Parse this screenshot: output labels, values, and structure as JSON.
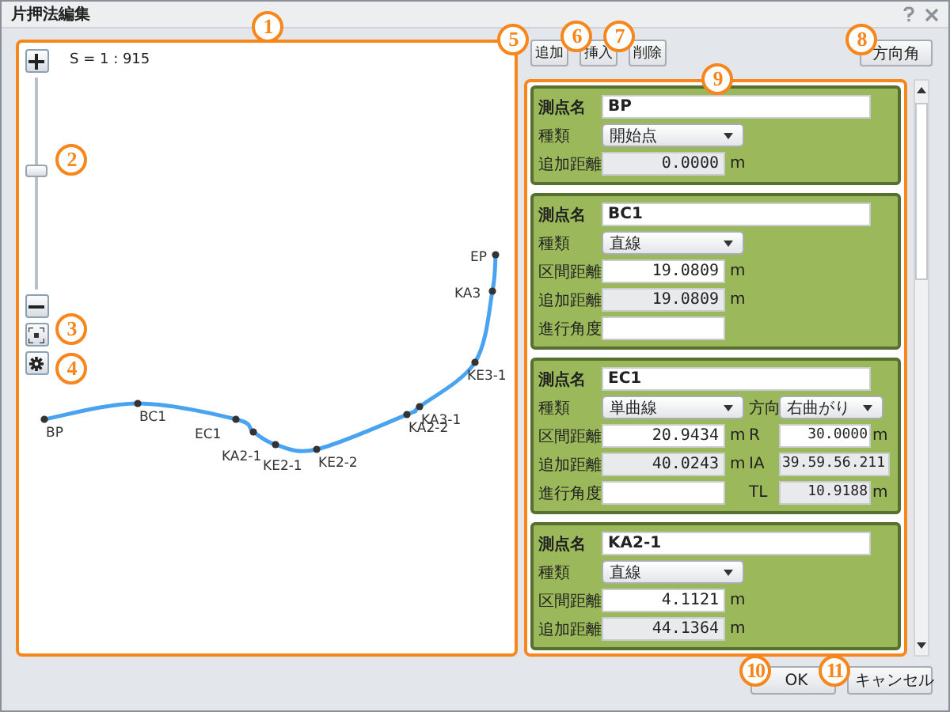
{
  "window": {
    "title": "片押法編集"
  },
  "map": {
    "scale": "S = 1 : 915",
    "zoom": {
      "level": 0.57
    },
    "points": [
      {
        "label": "BP"
      },
      {
        "label": "BC1"
      },
      {
        "label": "EC1"
      },
      {
        "label": "KA2-1"
      },
      {
        "label": "KE2-1"
      },
      {
        "label": "KE2-2"
      },
      {
        "label": "KA2-2"
      },
      {
        "label": "KA3-1"
      },
      {
        "label": "KE3-1"
      },
      {
        "label": "KA3"
      },
      {
        "label": "EP"
      }
    ]
  },
  "toolbar": [
    "追加",
    "挿入",
    "削除"
  ],
  "direction_button": "方向角",
  "cards": [
    {
      "rows": [
        [
          {
            "kind": "name",
            "label": "測点名",
            "value": "BP"
          }
        ],
        [
          {
            "kind": "select",
            "label": "種類",
            "value": "開始点"
          }
        ],
        [
          {
            "kind": "readonly",
            "label": "追加距離",
            "value": "0.0000",
            "unit": "m"
          }
        ]
      ]
    },
    {
      "rows": [
        [
          {
            "kind": "name",
            "label": "測点名",
            "value": "BC1"
          }
        ],
        [
          {
            "kind": "select",
            "label": "種類",
            "value": "直線"
          }
        ],
        [
          {
            "kind": "input",
            "label": "区間距離",
            "value": "19.0809",
            "unit": "m"
          }
        ],
        [
          {
            "kind": "readonly",
            "label": "追加距離",
            "value": "19.0809",
            "unit": "m"
          }
        ],
        [
          {
            "kind": "input",
            "label": "進行角度"
          }
        ]
      ]
    },
    {
      "rows": [
        [
          {
            "kind": "name",
            "label": "測点名",
            "value": "EC1"
          }
        ],
        [
          {
            "kind": "select",
            "label": "種類",
            "value": "単曲線"
          },
          {
            "kind": "select",
            "label": "方向",
            "value": "右曲がり"
          }
        ],
        [
          {
            "kind": "input",
            "label": "区間距離",
            "value": "20.9434",
            "unit": "m"
          },
          {
            "kind": "input",
            "label": "R",
            "value": "30.0000",
            "unit": "m"
          }
        ],
        [
          {
            "kind": "readonly",
            "label": "追加距離",
            "value": "40.0243",
            "unit": "m"
          },
          {
            "kind": "readonly",
            "label": "IA",
            "value": "39.59.56.211"
          }
        ],
        [
          {
            "kind": "input",
            "label": "進行角度"
          },
          {
            "kind": "readonly",
            "label": "TL",
            "value": "10.9188",
            "unit": "m"
          }
        ]
      ]
    },
    {
      "rows": [
        [
          {
            "kind": "name",
            "label": "測点名",
            "value": "KA2-1"
          }
        ],
        [
          {
            "kind": "select",
            "label": "種類",
            "value": "直線"
          }
        ],
        [
          {
            "kind": "input",
            "label": "区間距離",
            "value": "4.1121",
            "unit": "m"
          }
        ],
        [
          {
            "kind": "readonly",
            "label": "追加距離",
            "value": "44.1364",
            "unit": "m"
          }
        ]
      ]
    }
  ],
  "buttons": [
    "OK",
    "キャンセル"
  ],
  "callouts": [
    "1",
    "2",
    "3",
    "4",
    "5",
    "6",
    "7",
    "8",
    "9",
    "10",
    "11"
  ]
}
